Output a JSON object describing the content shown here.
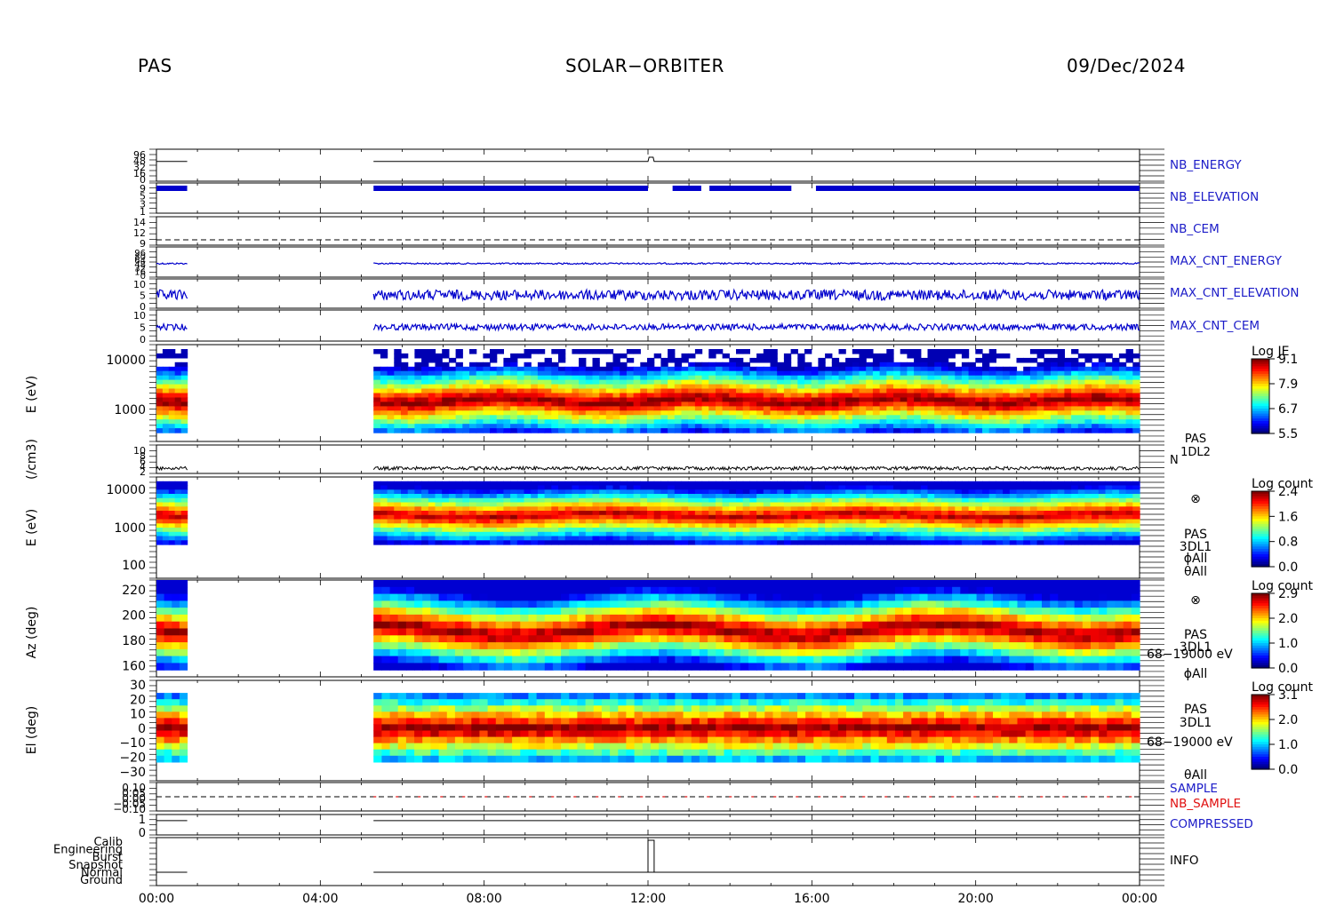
{
  "header": {
    "instrument": "PAS",
    "mission": "SOLAR−ORBITER",
    "date": "09/Dec/2024"
  },
  "colors": {
    "trace_blue": "#0000cc",
    "label_blue": "#1c1cc8",
    "label_red": "#e01010",
    "axis": "#000000"
  },
  "chart_data": {
    "type": "heatmap",
    "x_axis": {
      "ticks": [
        "00:00",
        "04:00",
        "08:00",
        "12:00",
        "16:00",
        "20:00",
        "00:00"
      ],
      "range_hours": [
        0,
        24
      ]
    },
    "data_gaps_hours": [
      [
        0.75,
        5.3
      ]
    ],
    "panels": [
      {
        "id": "nb_energy",
        "type": "line",
        "label": "NB_ENERGY",
        "label_color": "blue",
        "tick_labels": [
          "96",
          "48",
          "32",
          "16",
          "0"
        ],
        "series": [
          {
            "x": [
              0,
              0.75,
              5.3,
              12.0,
              12.1,
              24
            ],
            "y": [
              0,
              0,
              0,
              0,
              1,
              0
            ],
            "note_step_at_hour": 12.0
          }
        ]
      },
      {
        "id": "nb_elevation",
        "type": "line",
        "label": "NB_ELEVATION",
        "label_color": "blue",
        "tick_labels": [
          "9",
          "5",
          "3",
          "1"
        ],
        "series": [
          {
            "segments_hours": [
              [
                0,
                0.75
              ],
              [
                5.3,
                12.0
              ],
              [
                12.6,
                13.3
              ],
              [
                13.5,
                15.5
              ],
              [
                16.1,
                24
              ]
            ]
          }
        ]
      },
      {
        "id": "nb_cem",
        "type": "line",
        "label": "NB_CEM",
        "label_color": "blue",
        "tick_labels": [
          "14",
          "12",
          "9"
        ],
        "series": [
          {
            "x": [
              0,
              24
            ],
            "y": [
              9,
              9
            ],
            "style": "dashed"
          }
        ]
      },
      {
        "id": "max_cnt_energy",
        "type": "line",
        "label": "MAX_CNT_ENERGY",
        "label_color": "blue",
        "tick_labels": [
          "96",
          "80",
          "64",
          "48",
          "32",
          "16",
          "0"
        ]
      },
      {
        "id": "max_cnt_elevation",
        "type": "line",
        "label": "MAX_CNT_ELEVATION",
        "label_color": "blue",
        "tick_labels": [
          "10",
          "5",
          "0"
        ]
      },
      {
        "id": "max_cnt_cem",
        "type": "line",
        "label": "MAX_CNT_CEM",
        "label_color": "blue",
        "tick_labels": [
          "10",
          "5",
          "0"
        ]
      },
      {
        "id": "energy_spectrogram",
        "type": "heatmap",
        "ylabel": "E (eV)",
        "yscale": "log",
        "ytick_labels": [
          "10000",
          "1000"
        ],
        "colorbar": {
          "title": "Log JE",
          "ticks": [
            "9.1",
            "7.9",
            "6.7",
            "5.5"
          ]
        },
        "peak_energy_eV": 1300
      },
      {
        "id": "density",
        "type": "line",
        "ylabel": "(/cm3)",
        "label": "N",
        "tick_labels": [
          "10",
          "8",
          "6",
          "4",
          "2"
        ],
        "side_text": [
          "PAS",
          "1DL2"
        ]
      },
      {
        "id": "energy_counts",
        "type": "heatmap",
        "ylabel": "E (eV)",
        "yscale": "log",
        "ytick_labels": [
          "10000",
          "1000",
          "100"
        ],
        "colorbar": {
          "title": "Log count",
          "ticks": [
            "2.4",
            "1.6",
            "0.8",
            "0.0"
          ]
        },
        "side_text": [
          "⊗",
          "PAS",
          "3DL1",
          "ϕAll",
          "θAll"
        ]
      },
      {
        "id": "azimuth",
        "type": "heatmap",
        "ylabel": "Az (deg)",
        "ytick_labels": [
          "220",
          "200",
          "180",
          "160"
        ],
        "ylim": [
          155,
          222
        ],
        "colorbar": {
          "title": "Log count",
          "ticks": [
            "2.9",
            "2.0",
            "1.0",
            "0.0"
          ]
        },
        "side_text": [
          "⊗",
          "PAS",
          "3DL1",
          "68−19000 eV",
          "ϕAll"
        ]
      },
      {
        "id": "elevation",
        "type": "heatmap",
        "ylabel": "El (deg)",
        "ytick_labels": [
          "30",
          "20",
          "10",
          "0",
          "−10",
          "−20",
          "−30"
        ],
        "ylim": [
          -30,
          30
        ],
        "colorbar": {
          "title": "Log count",
          "ticks": [
            "3.1",
            "2.0",
            "1.0",
            "0.0"
          ]
        },
        "side_text": [
          "PAS",
          "3DL1",
          "68−19000 eV",
          "θAll"
        ]
      },
      {
        "id": "sample",
        "type": "line",
        "tick_labels": [
          "0.10",
          "0.05",
          "0.00",
          "−0.05",
          "−0.10"
        ],
        "labels": [
          {
            "text": "SAMPLE",
            "color": "blue"
          },
          {
            "text": "NB_SAMPLE",
            "color": "red"
          }
        ]
      },
      {
        "id": "compressed",
        "type": "line",
        "label": "COMPRESSED",
        "label_color": "blue",
        "tick_labels": [
          "1",
          "0"
        ]
      },
      {
        "id": "info",
        "type": "line",
        "label": "INFO",
        "label_color": "black",
        "tick_labels": [
          "Calib",
          "Engineering",
          "Burst",
          "Snapshot",
          "Normal",
          "Ground"
        ],
        "series": [
          {
            "x": [
              0,
              0.75,
              5.3,
              12.0,
              12.15,
              24
            ],
            "state": [
              "Normal",
              "Normal",
              "Normal",
              "Calib",
              "Normal",
              "Normal"
            ]
          }
        ]
      }
    ]
  }
}
